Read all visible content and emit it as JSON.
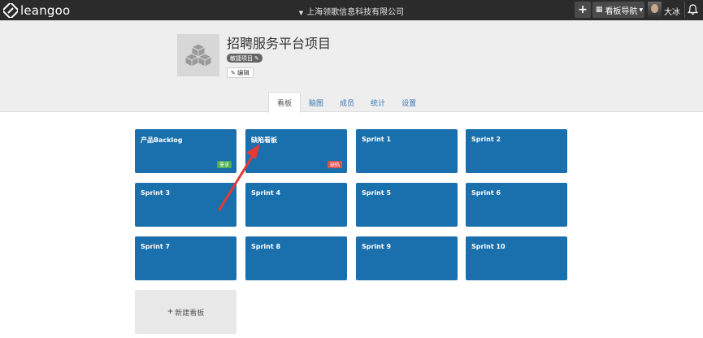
{
  "topbar": {
    "brand": "leangoo",
    "company": "上海领歌信息科技有限公司",
    "add_label": "+",
    "nav_label": "看板导航",
    "user_name": "大冰"
  },
  "project": {
    "title": "招聘服务平台项目",
    "badge": "敏捷项目",
    "edit_label": "编辑"
  },
  "tabs": [
    {
      "label": "看板",
      "active": true
    },
    {
      "label": "脑图",
      "active": false
    },
    {
      "label": "成员",
      "active": false
    },
    {
      "label": "统计",
      "active": false
    },
    {
      "label": "设置",
      "active": false
    }
  ],
  "boards": [
    {
      "name": "产品Backlog",
      "tag": "需求",
      "tag_color": "#4caf50"
    },
    {
      "name": "缺陷看板",
      "tag": "缺陷",
      "tag_color": "#d9534f"
    },
    {
      "name": "Sprint 1"
    },
    {
      "name": "Sprint 2"
    },
    {
      "name": "Sprint 3"
    },
    {
      "name": "Sprint 4"
    },
    {
      "name": "Sprint 5"
    },
    {
      "name": "Sprint 6"
    },
    {
      "name": "Sprint 7"
    },
    {
      "name": "Sprint 8"
    },
    {
      "name": "Sprint 9"
    },
    {
      "name": "Sprint 10"
    }
  ],
  "new_board_label": "新建看板",
  "colors": {
    "board_blue": "#1a6fad",
    "topbar": "#2b2b2b",
    "annotation_arrow": "#e53935"
  }
}
